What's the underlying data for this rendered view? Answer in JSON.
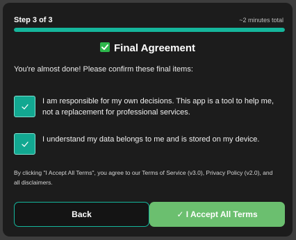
{
  "header": {
    "step_label": "Step 3 of 3",
    "time_estimate": "~2 minutes total",
    "progress_fraction": 1.0
  },
  "title": {
    "icon": "checkbox-check-icon",
    "text": "Final Agreement"
  },
  "intro": "You're almost done! Please confirm these final items:",
  "items": [
    {
      "text_line1": "I am responsible for my own decisions. This app is a tool to help me,",
      "text_line2": "not a replacement for professional services.",
      "checked": true
    },
    {
      "text_line1": "I understand my data belongs to me and is stored on my device.",
      "checked": true
    }
  ],
  "legal": {
    "line1": "By clicking \"I Accept All Terms\", you agree to our Terms of Service (v3.0), Privacy Policy (v2.0), and",
    "line2": "all disclaimers."
  },
  "buttons": {
    "back": "Back",
    "accept": "✓ I Accept All Terms"
  },
  "colors": {
    "accent": "#15b69c",
    "accept_button": "#6bbf6f",
    "title_icon": "#2db84c"
  }
}
